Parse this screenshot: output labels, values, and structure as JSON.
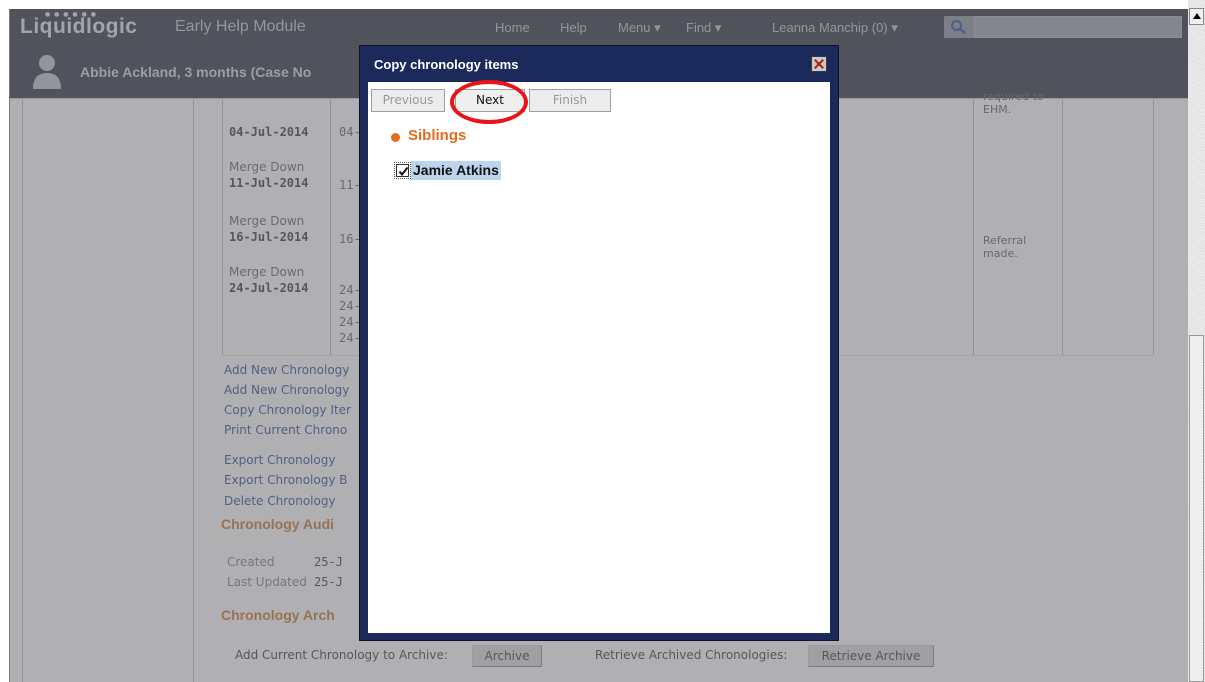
{
  "topbar": {
    "logo": "Liquidlogic",
    "app_title": "Early Help Module",
    "nav": [
      "Home",
      "Help",
      "Menu ▾",
      "Find ▾",
      "Leanna Manchip (0) ▾"
    ]
  },
  "person": {
    "name": "Abbie Ackland, 3 months (Case No"
  },
  "chronology_rows": [
    {
      "label": "",
      "date": "04-Jul-2014",
      "trunc": "04-"
    },
    {
      "label": "Merge Down",
      "date": "11-Jul-2014",
      "trunc": "11-"
    },
    {
      "label": "Merge Down",
      "date": "16-Jul-2014",
      "trunc": "16-"
    },
    {
      "label": "Merge Down",
      "date": "24-Jul-2014",
      "trunc": [
        "24-",
        "24-",
        "24-",
        "24-"
      ]
    }
  ],
  "right_notes": {
    "note1": "required to\nEHM.",
    "note2": "Referral\nmade."
  },
  "links": [
    "Add New Chronology",
    "Add New Chronology",
    "Copy Chronology Iter",
    "Print Current Chrono",
    "Export Chronology",
    "Export Chronology B",
    "Delete Chronology"
  ],
  "audit": {
    "heading": "Chronology Audi",
    "created_label": "Created",
    "created_value": "25-J",
    "updated_label": "Last Updated",
    "updated_value": "25-J"
  },
  "archive": {
    "heading": "Chronology Arch",
    "add_label": "Add Current Chronology to Archive:",
    "add_button": "Archive",
    "retrieve_label": "Retrieve Archived Chronologies:",
    "retrieve_button": "Retrieve Archive"
  },
  "modal": {
    "title": "Copy chronology items",
    "buttons": {
      "previous": "Previous",
      "next": "Next",
      "finish": "Finish"
    },
    "section_label": "Siblings",
    "items": [
      {
        "label": "Jamie Atkins",
        "checked": true
      }
    ]
  },
  "colors": {
    "topbar": "#4a4e5a",
    "modal_frame": "#1b2a5a",
    "accent_orange": "#e46c1e",
    "highlight_ring": "#e8141a",
    "selection": "#bcd5ec"
  },
  "icons": [
    "search-icon",
    "avatar-icon",
    "close-icon",
    "checkbox-checked-icon"
  ]
}
